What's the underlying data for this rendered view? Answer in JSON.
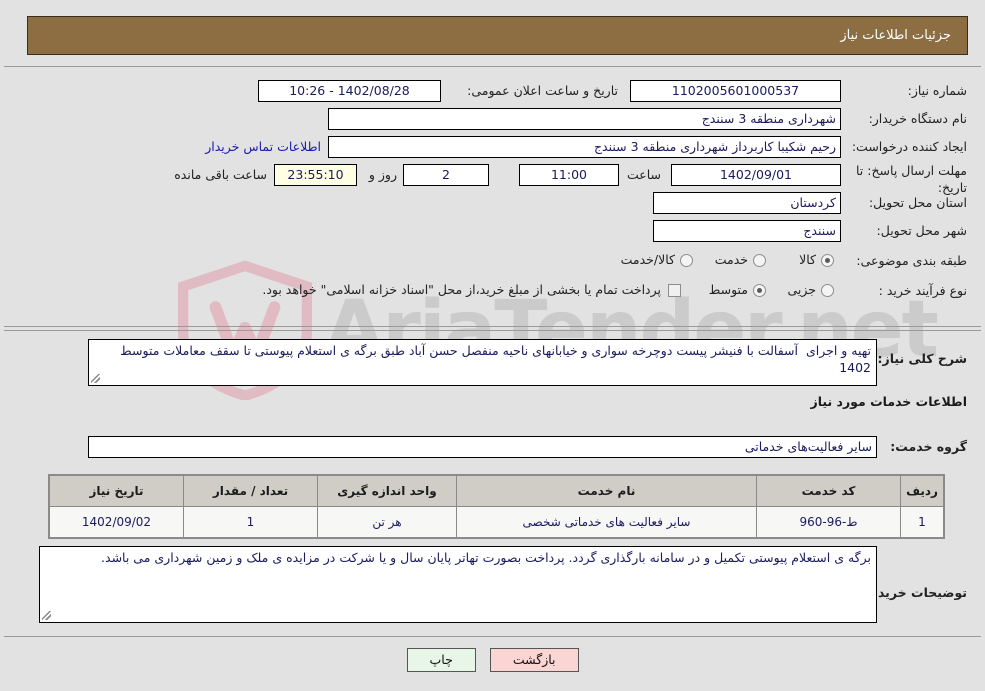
{
  "header": {
    "title": "جزئیات اطلاعات نیاز"
  },
  "top_form": {
    "need_number_label": "شماره نیاز:",
    "need_number_value": "1102005601000537",
    "announce_label": "تاریخ و ساعت اعلان عمومی:",
    "announce_value": "1402/08/28 - 10:26",
    "buyer_org_label": "نام دستگاه خریدار:",
    "buyer_org_value": "شهرداری منطقه 3 سنندج",
    "creator_label": "ایجاد کننده درخواست:",
    "creator_value": "رحیم شکیبا کاربرداز شهرداری منطقه 3 سنندج",
    "contact_link": "اطلاعات تماس خریدار",
    "deadline_label": "مهلت ارسال پاسخ: تا تاریخ:",
    "deadline_date": "1402/09/01",
    "hour_label": "ساعت",
    "deadline_time": "11:00",
    "days_value": "2",
    "days_label": "روز و",
    "countdown_value": "23:55:10",
    "remaining_label": "ساعت باقی مانده",
    "province_label": "استان محل تحویل:",
    "province_value": "کردستان",
    "city_label": "شهر محل تحویل:",
    "city_value": "سنندج",
    "category_label": "طبقه بندی موضوعی:",
    "category_options": [
      {
        "label": "کالا",
        "selected": false
      },
      {
        "label": "خدمت",
        "selected": true
      },
      {
        "label": "کالا/خدمت",
        "selected": false
      }
    ],
    "process_label": "نوع فرآیند خرید :",
    "process_options": [
      {
        "label": "جزیی",
        "selected": false
      },
      {
        "label": "متوسط",
        "selected": true
      }
    ],
    "treasury_checkbox_label": "پرداخت تمام یا بخشی از مبلغ خرید،از محل \"اسناد خزانه اسلامی\" خواهد بود.",
    "treasury_checked": false
  },
  "main": {
    "need_desc_label": "شرح کلی نیاز:",
    "need_desc_value": "تهیه و اجرای  آسفالت با فنیشر پیست دوچرخه سواری و خیابانهای ناحیه منفصل حسن آباد طبق برگه ی استعلام پیوستی تا سقف معاملات متوسط 1402",
    "services_heading": "اطلاعات خدمات مورد نیاز",
    "service_group_label": "گروه خدمت:",
    "service_group_value": "سایر فعالیت‌های خدماتی",
    "table": {
      "headers": [
        "ردیف",
        "کد خدمت",
        "نام خدمت",
        "واحد اندازه گیری",
        "تعداد / مقدار",
        "تاریخ نیاز"
      ],
      "rows": [
        [
          "1",
          "ط-96-960",
          "سایر فعالیت های خدماتی شخصی",
          "هر تن",
          "1",
          "1402/09/02"
        ]
      ]
    },
    "buyer_notes_label": "توضیحات خریدار:",
    "buyer_notes_value": "برگه ی استعلام پیوستی تکمیل و در سامانه بارگذاری گردد. پرداخت بصورت تهاتر پایان سال و یا شرکت در مزایده ی ملک و زمین شهرداری می باشد."
  },
  "buttons": {
    "print": "چاپ",
    "back": "بازگشت"
  },
  "watermark": {
    "text": "AriaTender.net"
  },
  "colors": {
    "header_bg": "#8d6e42",
    "link": "#1a1ab0",
    "field_text": "#1a1a5e",
    "print_btn": "#e8f6e8",
    "back_btn": "#fbd4d4",
    "countdown_bg": "#ffffe4"
  }
}
